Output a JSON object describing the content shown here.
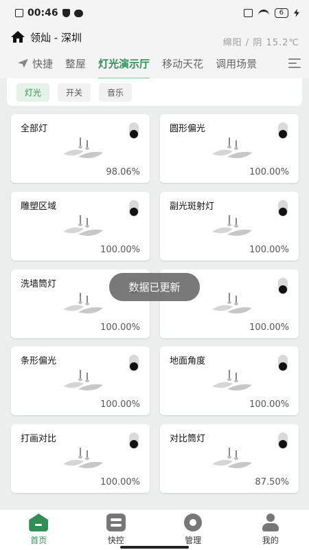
{
  "status_bar": {
    "time": "00:46",
    "battery": "6"
  },
  "header": {
    "home_name": "领灿 - 深圳",
    "weather": "绵阳 / 阴 15.2℃"
  },
  "nav": {
    "items": [
      {
        "label": "快捷",
        "icon": "send-icon"
      },
      {
        "label": "整屋"
      },
      {
        "label": "灯光演示厅",
        "active": true
      },
      {
        "label": "移动天花"
      },
      {
        "label": "调用场景"
      }
    ]
  },
  "subtabs": {
    "items": [
      "灯光",
      "开关",
      "音乐"
    ],
    "active_index": 0
  },
  "lights": [
    {
      "name": "全部灯",
      "brightness": "98.06%"
    },
    {
      "name": "圆形偏光",
      "brightness": "100.00%"
    },
    {
      "name": "雕塑区域",
      "brightness": "100.00%"
    },
    {
      "name": "副光斑射灯",
      "brightness": "100.00%"
    },
    {
      "name": "洗墙筒灯",
      "brightness": "100.00%"
    },
    {
      "name": "",
      "brightness": "100.00%"
    },
    {
      "name": "条形偏光",
      "brightness": "100.00%"
    },
    {
      "name": "地面角度",
      "brightness": "100.00%"
    },
    {
      "name": "打画对比",
      "brightness": "100.00%"
    },
    {
      "name": "对比筒灯",
      "brightness": "87.50%"
    }
  ],
  "toast": "数据已更新",
  "bottom_nav": {
    "items": [
      {
        "label": "首页",
        "icon": "home-icon",
        "active": true
      },
      {
        "label": "快控",
        "icon": "quick-control-icon"
      },
      {
        "label": "管理",
        "icon": "gear-icon"
      },
      {
        "label": "我的",
        "icon": "user-icon"
      }
    ]
  },
  "colors": {
    "accent": "#2f8f55",
    "background": "#eceeed",
    "card": "#ffffff"
  }
}
